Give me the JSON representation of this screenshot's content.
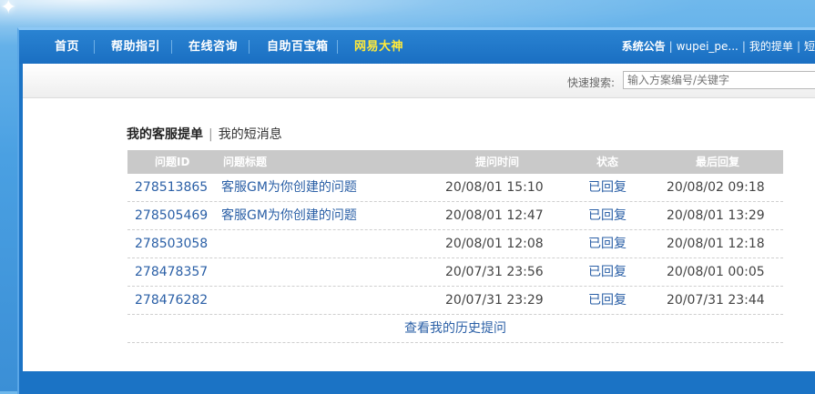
{
  "nav": {
    "items": [
      {
        "label": "首页",
        "active": false
      },
      {
        "label": "帮助指引",
        "active": false
      },
      {
        "label": "在线咨询",
        "active": false
      },
      {
        "label": "自助百宝箱",
        "active": false
      },
      {
        "label": "网易大神",
        "active": true
      }
    ],
    "right": {
      "system_notice": "系统公告",
      "username": "wupei_pe...",
      "my_tickets": "我的提单",
      "truncated": "短"
    }
  },
  "search": {
    "label": "快速搜索:",
    "placeholder": "输入方案编号/关键字"
  },
  "tabs": {
    "active": "我的客服提单",
    "separator": "|",
    "other": "我的短消息"
  },
  "table": {
    "headers": {
      "id": "问题ID",
      "title": "问题标题",
      "time": "提问时间",
      "status": "状态",
      "last_reply": "最后回复"
    },
    "rows": [
      {
        "id": "278513865",
        "title": "客服GM为你创建的问题",
        "time": "20/08/01 15:10",
        "status": "已回复",
        "last_reply": "20/08/02 09:18"
      },
      {
        "id": "278505469",
        "title": "客服GM为你创建的问题",
        "time": "20/08/01 12:47",
        "status": "已回复",
        "last_reply": "20/08/01 13:29"
      },
      {
        "id": "278503058",
        "title": "",
        "time": "20/08/01 12:08",
        "status": "已回复",
        "last_reply": "20/08/01 12:18"
      },
      {
        "id": "278478357",
        "title": "",
        "time": "20/07/31 23:56",
        "status": "已回复",
        "last_reply": "20/08/01 00:05"
      },
      {
        "id": "278476282",
        "title": "",
        "time": "20/07/31 23:29",
        "status": "已回复",
        "last_reply": "20/07/31 23:44"
      }
    ],
    "history_link": "查看我的历史提问"
  },
  "colors": {
    "nav_bg": "#1a6fc2",
    "active_nav": "#ffea3b",
    "link": "#2a5fa6",
    "header_bg": "#c9c9c9"
  }
}
